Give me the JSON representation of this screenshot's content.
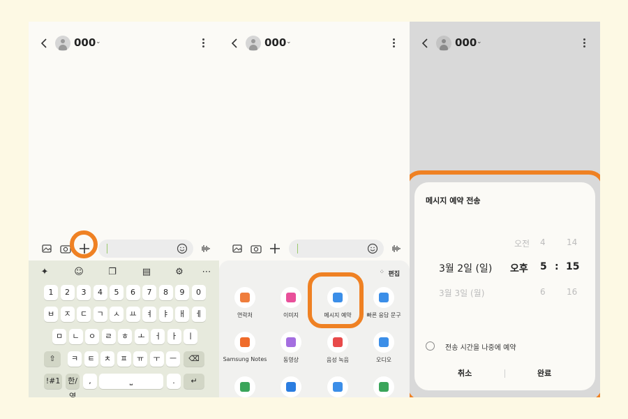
{
  "contact": {
    "name": "000"
  },
  "keyboard": {
    "row1": [
      "1",
      "2",
      "3",
      "4",
      "5",
      "6",
      "7",
      "8",
      "9",
      "0"
    ],
    "row2": [
      "ㅂ",
      "ㅈ",
      "ㄷ",
      "ㄱ",
      "ㅅ",
      "ㅛ",
      "ㅕ",
      "ㅑ",
      "ㅐ",
      "ㅔ"
    ],
    "row3": [
      "ㅁ",
      "ㄴ",
      "ㅇ",
      "ㄹ",
      "ㅎ",
      "ㅗ",
      "ㅓ",
      "ㅏ",
      "ㅣ"
    ],
    "row4": [
      "ㅋ",
      "ㅌ",
      "ㅊ",
      "ㅍ",
      "ㅠ",
      "ㅜ",
      "ㅡ"
    ],
    "sym_key": "!#1",
    "lang_key": "한/영",
    "comma": ",",
    "period": "."
  },
  "attach": {
    "edit_label": "편집",
    "apps": [
      {
        "label": "연락처",
        "icon": "contact-icon",
        "color": "#ef7d3c"
      },
      {
        "label": "이미지",
        "icon": "image-icon",
        "color": "#e8509a"
      },
      {
        "label": "메시지 예약",
        "icon": "schedule-message-icon",
        "color": "#3b8ee8"
      },
      {
        "label": "빠른 응답 문구",
        "icon": "quick-reply-icon",
        "color": "#3b8ee8"
      },
      {
        "label": "Samsung Notes",
        "icon": "notes-icon",
        "color": "#ef6b2a"
      },
      {
        "label": "동영상",
        "icon": "video-icon",
        "color": "#a46ee0"
      },
      {
        "label": "음성 녹음",
        "icon": "mic-icon",
        "color": "#e84a4a"
      },
      {
        "label": "오디오",
        "icon": "audio-icon",
        "color": "#3b8ee8"
      },
      {
        "label": "",
        "icon": "location-icon",
        "color": "#3aa55a"
      },
      {
        "label": "",
        "icon": "shield-icon",
        "color": "#2b7de0"
      },
      {
        "label": "",
        "icon": "chat-icon",
        "color": "#3b8ee8"
      },
      {
        "label": "",
        "icon": "calendar-icon",
        "color": "#3aa55a"
      }
    ]
  },
  "dialog": {
    "title": "메시지 예약 전송",
    "date_selected": "3월 2일 (일)",
    "date_next": "3월 3일 (월)",
    "ampm_prev": "오전",
    "ampm_selected": "오후",
    "hour_prev": "4",
    "hour_selected": "5",
    "hour_next": "6",
    "minute_prev": "14",
    "minute_selected": "15",
    "minute_next": "16",
    "colon": ":",
    "later_option": "전송 시간을 나중에 예약",
    "cancel": "취소",
    "done": "완료"
  },
  "colors": {
    "highlight": "#ef8123",
    "background": "#fdf9e4"
  }
}
